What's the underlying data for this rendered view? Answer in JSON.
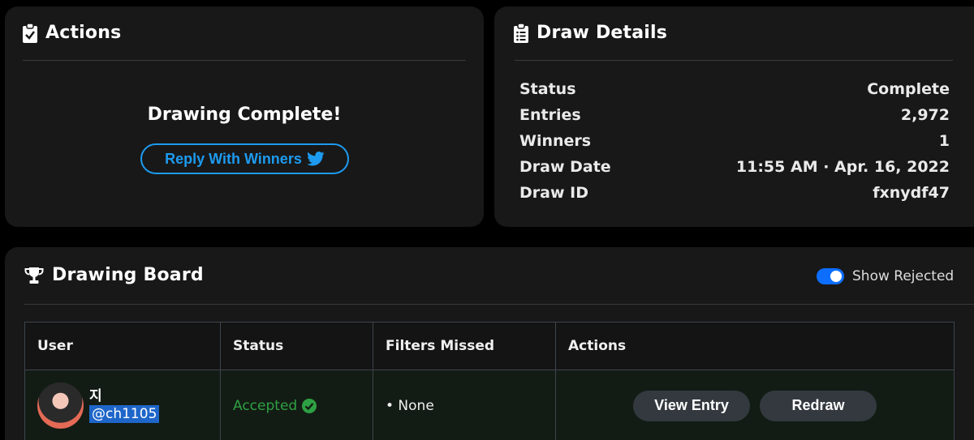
{
  "actions_card": {
    "title": "Actions",
    "complete_message": "Drawing Complete!",
    "reply_button_label": "Reply With Winners"
  },
  "details_card": {
    "title": "Draw Details",
    "rows": [
      {
        "label": "Status",
        "value": "Complete"
      },
      {
        "label": "Entries",
        "value": "2,972"
      },
      {
        "label": "Winners",
        "value": "1"
      },
      {
        "label": "Draw Date",
        "value": "11:55 AM · Apr. 16, 2022"
      },
      {
        "label": "Draw ID",
        "value": "fxnydf47"
      }
    ]
  },
  "board": {
    "title": "Drawing Board",
    "toggle_label": "Show Rejected",
    "toggle_on": true,
    "columns": [
      "User",
      "Status",
      "Filters Missed",
      "Actions"
    ],
    "rows": [
      {
        "user_name": "지",
        "user_handle": "@ch1105",
        "status": "Accepted",
        "filters_missed": "• None",
        "view_label": "View Entry",
        "redraw_label": "Redraw"
      }
    ]
  },
  "colors": {
    "accent": "#1d9bf0",
    "accepted": "#2ea043",
    "toggle": "#0d6efd"
  }
}
